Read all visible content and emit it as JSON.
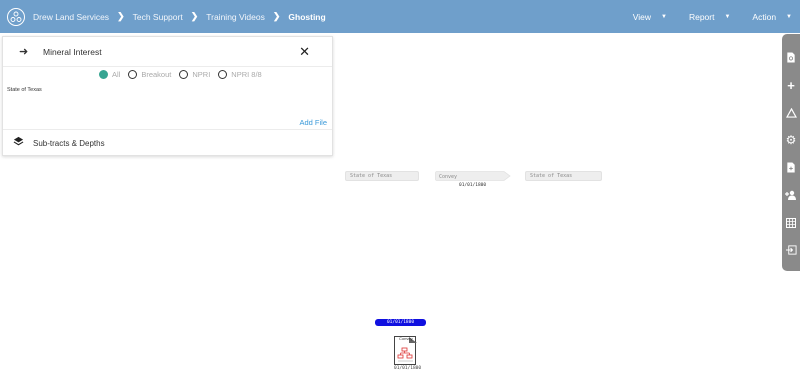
{
  "header": {
    "logo_icon": "network-circle-icon",
    "breadcrumbs": [
      "Drew Land Services",
      "Tech Support",
      "Training Videos",
      "Ghosting"
    ],
    "menus": [
      "View",
      "Report",
      "Action"
    ]
  },
  "panel": {
    "title": "Mineral Interest",
    "radio_options": [
      "All",
      "Breakout",
      "NPRI",
      "NPRI 8/8"
    ],
    "selected_option": "All",
    "region": "State of Texas",
    "add_file": "Add File",
    "sub_section": "Sub-tracts & Depths"
  },
  "flow": {
    "left_node": "State of Texas",
    "conveyance_node": "Convey",
    "conveyance_date": "01/01/1800",
    "right_node": "State of Texas"
  },
  "sidebar": {
    "icons": [
      "document-search-icon",
      "plus-icon",
      "warning-triangle-icon",
      "gear-icon",
      "file-add-icon",
      "add-user-icon",
      "grid-icon",
      "exit-icon"
    ]
  },
  "timeline": {
    "date_badge": "01/01/1800",
    "doc_label": "Convey",
    "doc_date": "01/01/1800"
  },
  "colors": {
    "topbar": "#6f9fcb",
    "radio_selected": "#37a592",
    "link": "#3b9ad9",
    "date_badge": "#1010e0",
    "sidebar": "#8a8a8a"
  }
}
